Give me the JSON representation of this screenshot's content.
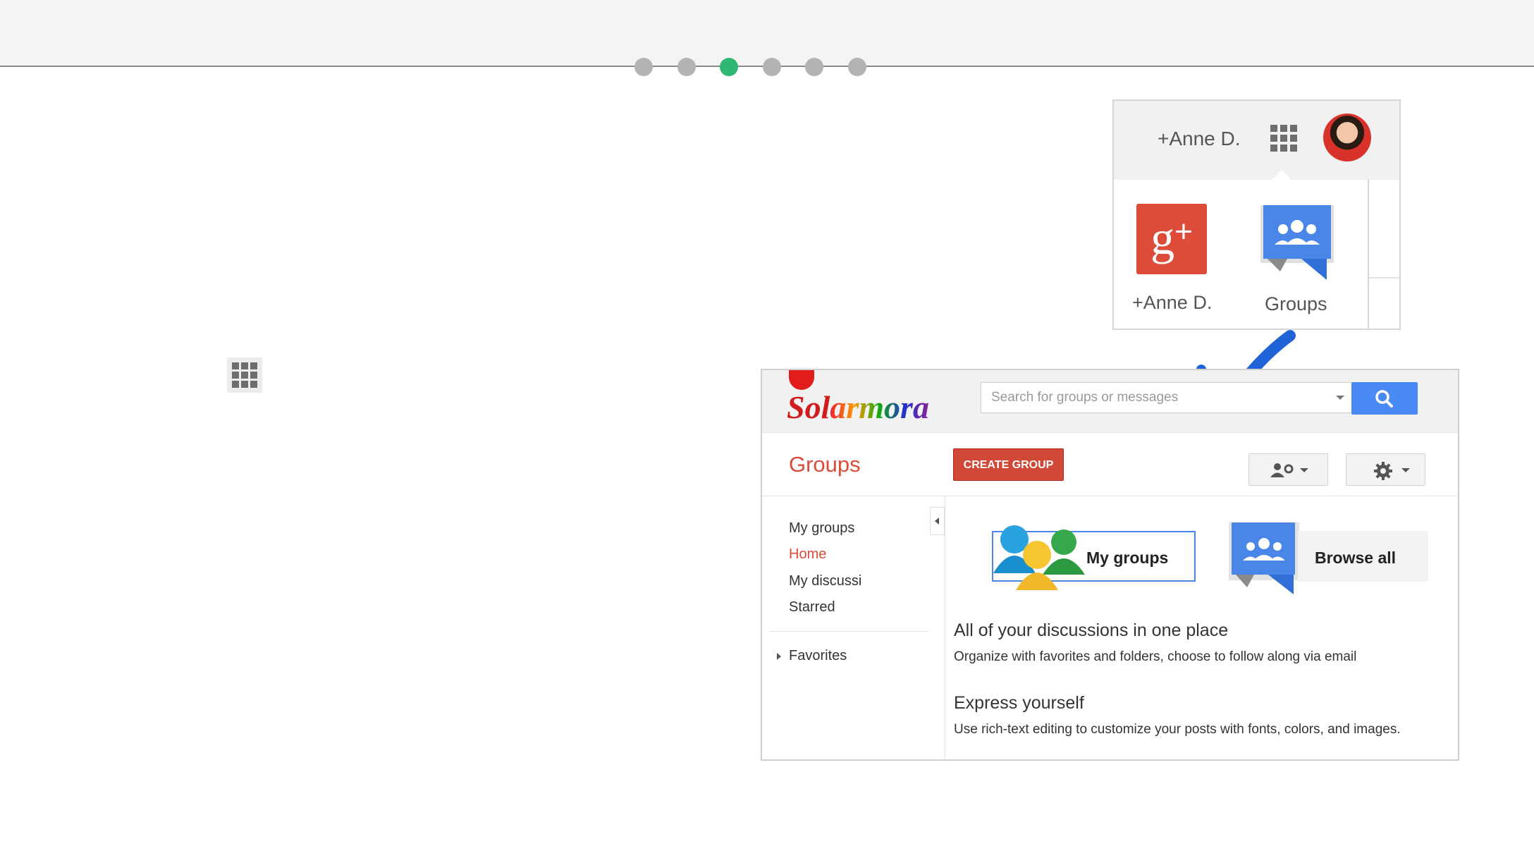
{
  "slides": {
    "dots": [
      {
        "active": false
      },
      {
        "active": false
      },
      {
        "active": true
      },
      {
        "active": false
      },
      {
        "active": false
      },
      {
        "active": false
      }
    ],
    "active_color": "#2eb872",
    "inactive_color": "#b3b3b3"
  },
  "account_bar": {
    "profile_name": "+Anne D.",
    "apps_icon": "apps-grid-icon",
    "avatar_icon": "profile-avatar",
    "apps": [
      {
        "label": "+Anne D.",
        "icon": "google-plus-icon"
      },
      {
        "label": "Groups",
        "icon": "groups-icon"
      }
    ]
  },
  "groups_page": {
    "logo_text": "Solarmora",
    "search": {
      "placeholder": "Search for groups or messages"
    },
    "title": "Groups",
    "create_button": "CREATE GROUP",
    "sidebar": {
      "items": [
        {
          "label": "My groups",
          "active": false
        },
        {
          "label": "Home",
          "active": true
        },
        {
          "label": "My discussi",
          "active": false
        },
        {
          "label": "Starred",
          "active": false
        }
      ],
      "favorites": "Favorites"
    },
    "my_groups_button": "My groups",
    "browse_all_button": "Browse all",
    "features": [
      {
        "heading": "All of your discussions in one place",
        "text": "Organize with favorites and folders, choose to follow along via email"
      },
      {
        "heading": "Express yourself",
        "text": "Use rich-text editing to customize your posts with fonts, colors, and images."
      }
    ]
  },
  "colors": {
    "accent_red": "#dd4b39",
    "search_blue": "#4a8af4",
    "arrow_blue": "#1f63d6"
  }
}
